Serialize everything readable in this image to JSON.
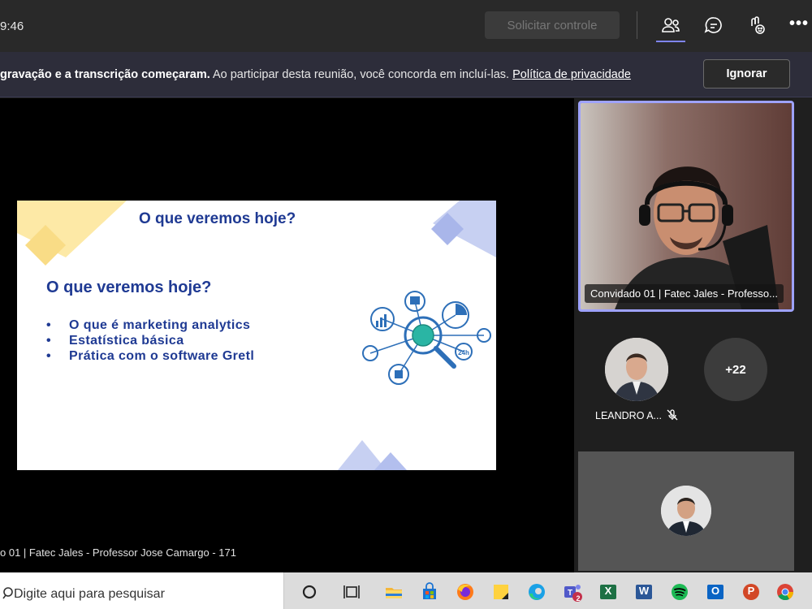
{
  "topbar": {
    "clock": "9:46",
    "request_control": "Solicitar controle",
    "more": "•••"
  },
  "banner": {
    "bold_text": "gravação e a transcrição começaram.",
    "text": " Ao participar desta reunião, você concorda em incluí-las. ",
    "link": "Política de privacidade",
    "ignore": "Ignorar"
  },
  "slide": {
    "title": "O que veremos hoje?",
    "heading": "O que veremos hoje?",
    "bullet": "•",
    "items": [
      "O que é marketing analytics",
      "Estatística básica",
      "Prática com o software Gretl"
    ],
    "badge": "24h"
  },
  "stage": {
    "caption": "o 01 | Fatec Jales - Professor Jose Camargo - 171"
  },
  "participants": {
    "video_name": "Convidado 01 | Fatec Jales - Professo...",
    "leandro": "LEANDRO A...",
    "extra": "+22"
  },
  "taskbar": {
    "search_placeholder": "Digite aqui para pesquisar",
    "excel": "X",
    "word": "W",
    "outlook": "O",
    "powerpoint": "P",
    "teams_badge": "2"
  },
  "colors": {
    "accent": "#7f85f5",
    "slide_blue": "#1f3a93",
    "banner": "#2d2d3a"
  }
}
